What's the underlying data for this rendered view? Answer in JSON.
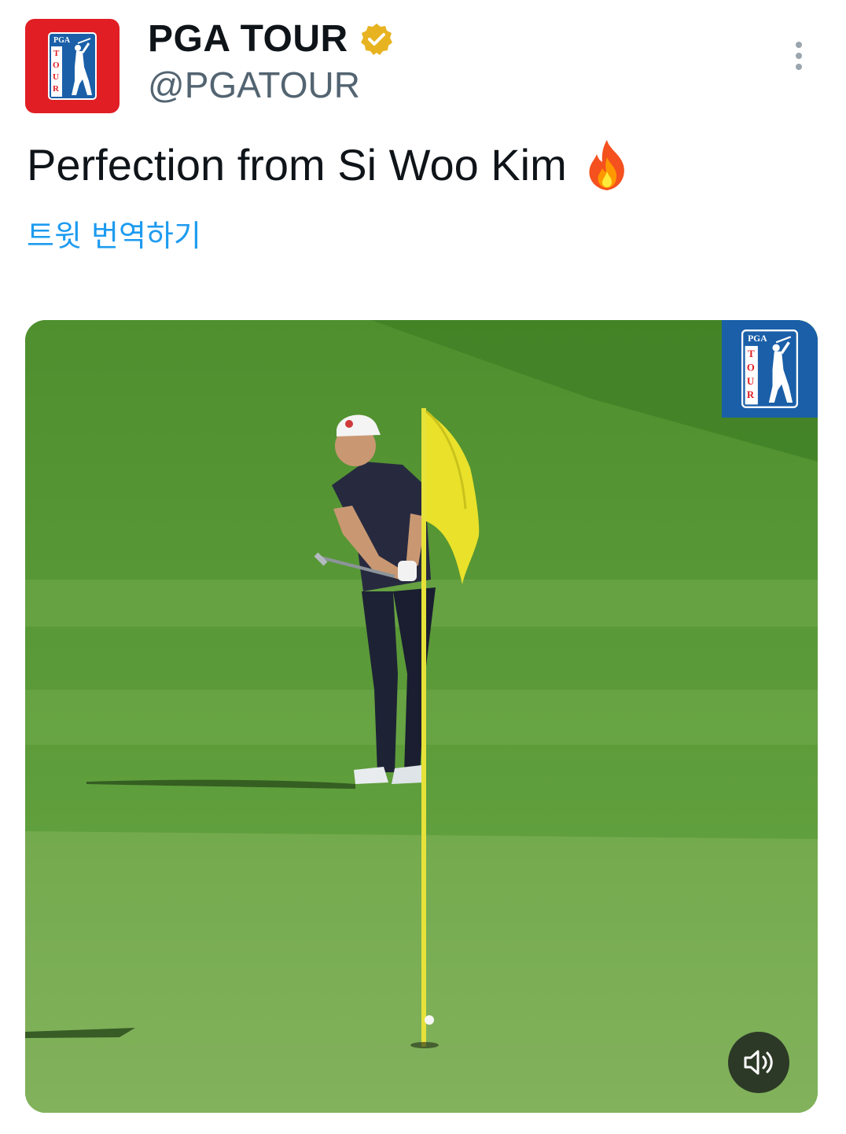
{
  "account": {
    "display_name": "PGA TOUR",
    "handle": "@PGATOUR",
    "verified": true,
    "avatar_icon": "pga-tour-logo-icon",
    "avatar_color": "#e01e24"
  },
  "tweet": {
    "text": "Perfection from Si Woo Kim",
    "emoji_icon": "fire-icon",
    "translate_label": "트윗 번역하기"
  },
  "media": {
    "type": "video",
    "watermark_icon": "pga-tour-watermark-icon",
    "sound_button_icon": "speaker-muted-icon"
  },
  "colors": {
    "link": "#1d9bf0",
    "verified_badge": "#e8b320",
    "secondary_text": "#536471"
  }
}
